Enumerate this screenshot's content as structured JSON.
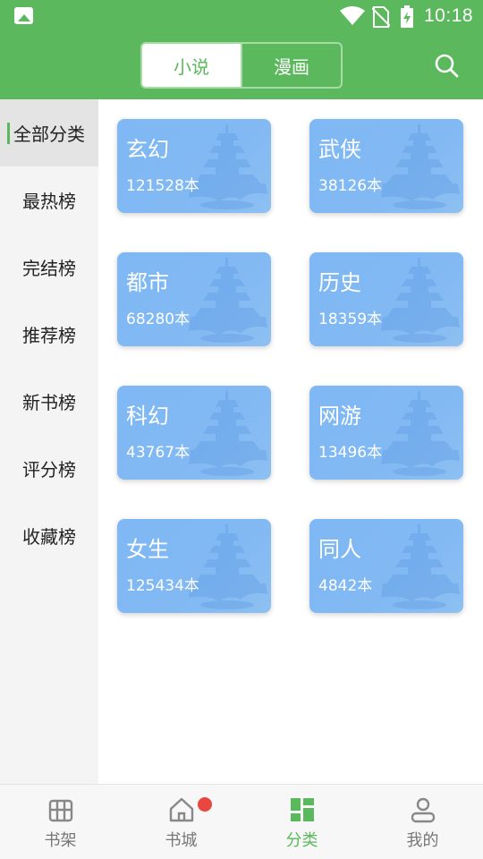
{
  "status_bar": {
    "time": "10:18"
  },
  "header": {
    "tabs": [
      {
        "label": "小说",
        "active": true
      },
      {
        "label": "漫画",
        "active": false
      }
    ],
    "accent_color": "#5cb85c"
  },
  "sidebar": {
    "items": [
      {
        "label": "全部分类",
        "active": true
      },
      {
        "label": "最热榜"
      },
      {
        "label": "完结榜"
      },
      {
        "label": "推荐榜"
      },
      {
        "label": "新书榜"
      },
      {
        "label": "评分榜"
      },
      {
        "label": "收藏榜"
      }
    ]
  },
  "categories": [
    {
      "name": "玄幻",
      "count": "121528本"
    },
    {
      "name": "武侠",
      "count": "38126本"
    },
    {
      "name": "都市",
      "count": "68280本"
    },
    {
      "name": "历史",
      "count": "18359本"
    },
    {
      "name": "科幻",
      "count": "43767本"
    },
    {
      "name": "网游",
      "count": "13496本"
    },
    {
      "name": "女生",
      "count": "125434本"
    },
    {
      "name": "同人",
      "count": "4842本"
    }
  ],
  "bottom_nav": {
    "items": [
      {
        "label": "书架",
        "icon": "bookshelf-icon"
      },
      {
        "label": "书城",
        "icon": "home-icon",
        "has_badge": true
      },
      {
        "label": "分类",
        "icon": "category-grid-icon",
        "active": true
      },
      {
        "label": "我的",
        "icon": "profile-icon"
      }
    ]
  }
}
